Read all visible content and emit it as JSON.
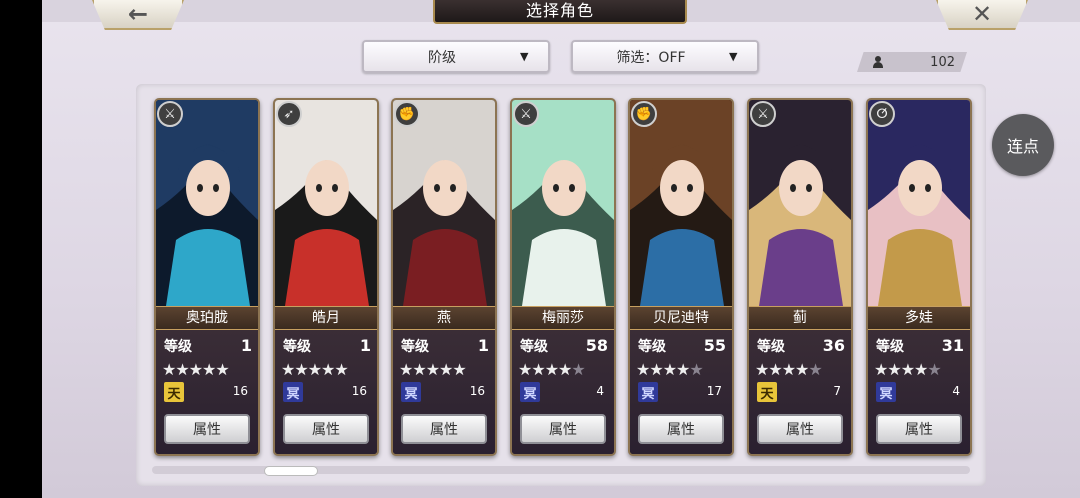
{
  "header": {
    "title": "选择角色",
    "back_icon": "←",
    "close_icon": "✕"
  },
  "filters": {
    "sort_label": "阶级",
    "filter_label": "筛选：OFF",
    "arrow": "▼"
  },
  "roster_count": "102",
  "renda_label": "连点",
  "level_label": "等级",
  "attr_label": "属性",
  "star_glyph": "★",
  "characters": [
    {
      "name": "奥珀胧",
      "level": "1",
      "stars": 5,
      "rank": "天",
      "rank_color": "gold",
      "rank_value": "16",
      "weapon_icon": "sword-icon",
      "weapon_glyph": "⚔",
      "palette": [
        "#1f3b63",
        "#2ea7c9",
        "#0d1a2c"
      ]
    },
    {
      "name": "皓月",
      "level": "1",
      "stars": 5,
      "rank": "冥",
      "rank_color": "blue",
      "rank_value": "16",
      "weapon_icon": "bow-icon",
      "weapon_glyph": "➶",
      "palette": [
        "#e8e4e0",
        "#c8302a",
        "#1a1a1a"
      ]
    },
    {
      "name": "燕",
      "level": "1",
      "stars": 5,
      "rank": "冥",
      "rank_color": "blue",
      "rank_value": "16",
      "weapon_icon": "fist-icon",
      "weapon_glyph": "✊",
      "palette": [
        "#d7d3cf",
        "#7a1e22",
        "#2b2326"
      ]
    },
    {
      "name": "梅丽莎",
      "level": "58",
      "stars": 4,
      "rank": "冥",
      "rank_color": "blue",
      "rank_value": "4",
      "weapon_icon": "sword-icon",
      "weapon_glyph": "⚔",
      "palette": [
        "#a6e0c6",
        "#e8f2ec",
        "#3c5c4e"
      ]
    },
    {
      "name": "贝尼迪特",
      "level": "55",
      "stars": 4,
      "rank": "冥",
      "rank_color": "blue",
      "rank_value": "17",
      "weapon_icon": "fist-icon",
      "weapon_glyph": "✊",
      "palette": [
        "#6b4226",
        "#2c6ea6",
        "#241a14"
      ]
    },
    {
      "name": "蓟",
      "level": "36",
      "stars": 4,
      "rank": "天",
      "rank_color": "gold",
      "rank_value": "7",
      "weapon_icon": "sword-icon",
      "weapon_glyph": "⚔",
      "palette": [
        "#2a2230",
        "#6a3e8a",
        "#d9b77a"
      ]
    },
    {
      "name": "多娃",
      "level": "31",
      "stars": 4,
      "rank": "冥",
      "rank_color": "blue",
      "rank_value": "4",
      "weapon_icon": "staff-icon",
      "weapon_glyph": "ⵚ",
      "palette": [
        "#2a2860",
        "#c39a4a",
        "#e8c0c4"
      ]
    }
  ]
}
